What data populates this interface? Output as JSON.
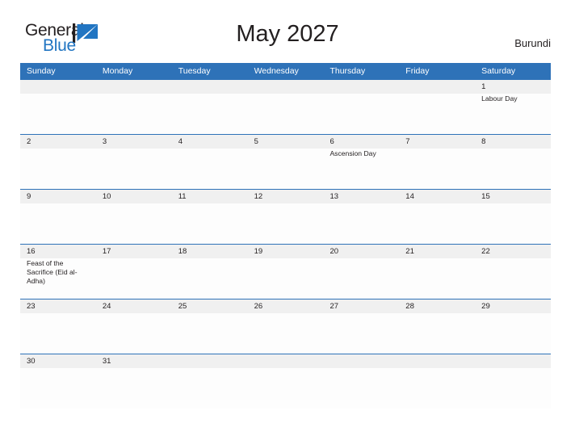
{
  "brand": {
    "name_part1": "General",
    "name_part2": "Blue",
    "mark": "triangle-logo-mark",
    "color_dark": "#231f20",
    "color_blue": "#2175c2"
  },
  "header": {
    "title": "May 2027",
    "country": "Burundi"
  },
  "theme": {
    "header_blue": "#2e72b8",
    "date_band": "#f0f0f0",
    "cell_bg": "#fdfdfd",
    "text": "#231f20"
  },
  "calendar": {
    "weekday_headers": [
      "Sunday",
      "Monday",
      "Tuesday",
      "Wednesday",
      "Thursday",
      "Friday",
      "Saturday"
    ],
    "weeks": [
      {
        "dates": [
          "",
          "",
          "",
          "",
          "",
          "",
          "1"
        ],
        "events": [
          "",
          "",
          "",
          "",
          "",
          "",
          "Labour Day"
        ]
      },
      {
        "dates": [
          "2",
          "3",
          "4",
          "5",
          "6",
          "7",
          "8"
        ],
        "events": [
          "",
          "",
          "",
          "",
          "Ascension Day",
          "",
          ""
        ]
      },
      {
        "dates": [
          "9",
          "10",
          "11",
          "12",
          "13",
          "14",
          "15"
        ],
        "events": [
          "",
          "",
          "",
          "",
          "",
          "",
          ""
        ]
      },
      {
        "dates": [
          "16",
          "17",
          "18",
          "19",
          "20",
          "21",
          "22"
        ],
        "events": [
          "Feast of the Sacrifice (Eid al-Adha)",
          "",
          "",
          "",
          "",
          "",
          ""
        ]
      },
      {
        "dates": [
          "23",
          "24",
          "25",
          "26",
          "27",
          "28",
          "29"
        ],
        "events": [
          "",
          "",
          "",
          "",
          "",
          "",
          ""
        ]
      },
      {
        "dates": [
          "30",
          "31",
          "",
          "",
          "",
          "",
          ""
        ],
        "events": [
          "",
          "",
          "",
          "",
          "",
          "",
          ""
        ]
      }
    ]
  }
}
